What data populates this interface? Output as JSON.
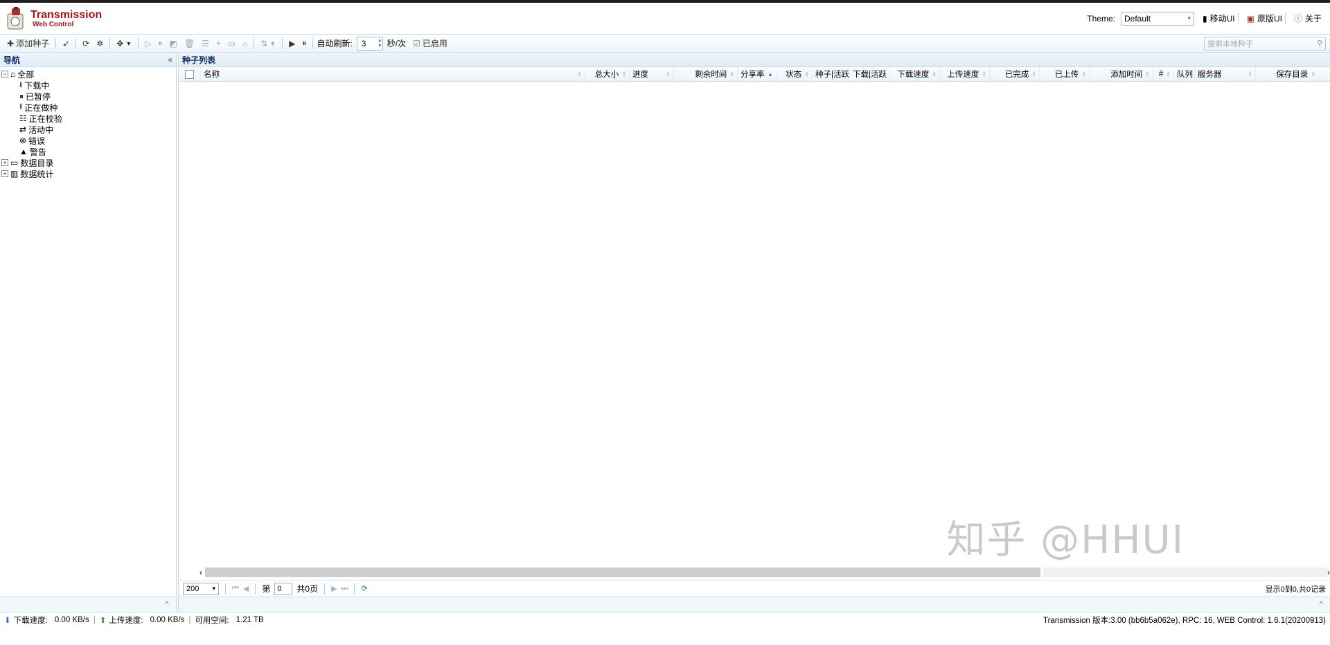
{
  "header": {
    "logo_title": "Transmission",
    "logo_subtitle": "Web Control",
    "theme_label": "Theme:",
    "theme_value": "Default",
    "links": [
      "移动UI",
      "原版UI",
      "关于"
    ]
  },
  "toolbar": {
    "add_torrent": "添加种子",
    "auto_refresh_label": "自动刷新:",
    "auto_refresh_value": "3",
    "per_unit": "秒/次",
    "enabled_label": "已启用",
    "search_placeholder": "搜索本地种子"
  },
  "nav": {
    "title": "导航",
    "root": "全部",
    "items": [
      "下载中",
      "已暂停",
      "正在做种",
      "正在校验",
      "活动中",
      "错误",
      "警告"
    ],
    "groups": [
      "数据目录",
      "数据统计"
    ]
  },
  "torrents": {
    "title": "种子列表",
    "columns": [
      "名称",
      "总大小",
      "进度",
      "剩余时间",
      "分享率",
      "状态",
      "种子|活跃",
      "下载|活跃",
      "下载速度",
      "上传速度",
      "已完成",
      "已上传",
      "添加时间",
      "#",
      "队列",
      "服务器",
      "保存目录"
    ],
    "rows": []
  },
  "pager": {
    "page_size": "200",
    "page_prefix": "第",
    "page_value": "0",
    "page_suffix": "共0页",
    "info": "显示0到0,共0记录"
  },
  "status": {
    "download_label": "下载速度:",
    "download_value": "0.00 KB/s",
    "upload_label": "上传速度:",
    "upload_value": "0.00 KB/s",
    "free_label": "可用空间:",
    "free_value": "1.21 TB",
    "version": "Transmission 版本:3.00 (bb6b5a062e), RPC: 16, WEB Control: 1.6.1(20200913)"
  },
  "watermark": "知乎 @HHUI",
  "colors": {
    "accent": "#a3151a",
    "panel_border": "#c5d9ec",
    "panel_title": "#0e2d5f"
  }
}
